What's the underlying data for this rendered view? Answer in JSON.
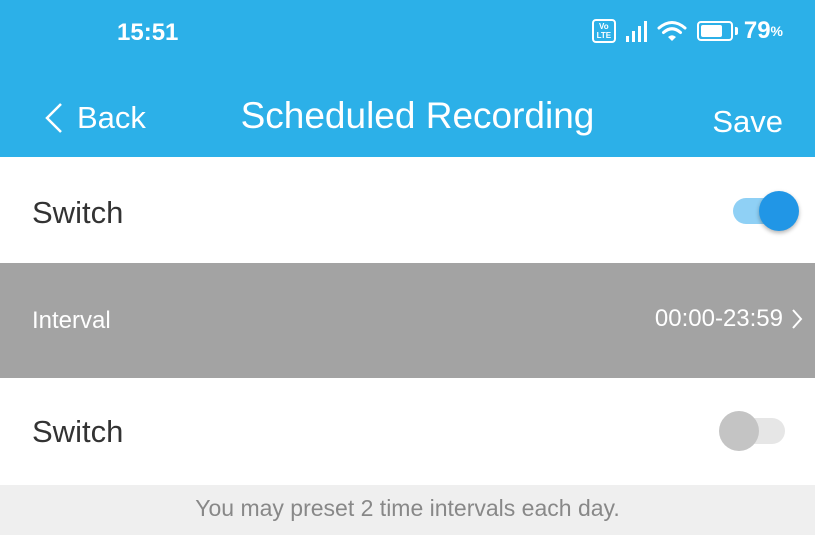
{
  "status_bar": {
    "time": "15:51",
    "volte_line1": "Vo",
    "volte_line2": "LTE",
    "battery_percent": "79",
    "battery_symbol": "%"
  },
  "nav": {
    "back_label": "Back",
    "title": "Scheduled Recording",
    "save_label": "Save"
  },
  "rows": {
    "switch1_label": "Switch",
    "switch1_on": true,
    "interval_label": "Interval",
    "interval_value": "00:00-23:59",
    "switch2_label": "Switch",
    "switch2_on": false
  },
  "hint_text": "You may preset 2 time intervals each day.",
  "colors": {
    "header": "#2cb0e8",
    "switch_on_knob": "#2196e6",
    "switch_on_track": "#8fd0f5",
    "switch_off_knob": "#c4c4c4",
    "switch_off_track": "#e6e6e6",
    "interval_bg": "#a3a3a3"
  }
}
